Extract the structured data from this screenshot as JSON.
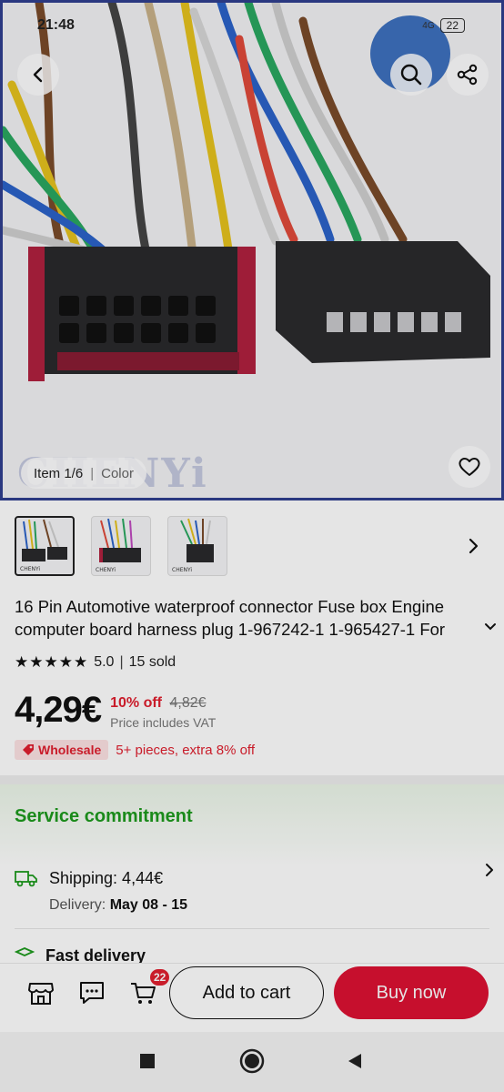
{
  "status_bar": {
    "time": "21:48",
    "signal": "4G",
    "battery": "22"
  },
  "hero": {
    "item_counter": "Item 1/6",
    "variant_label": "Color",
    "watermark": "CHENYi",
    "back_icon": "chevron-left-icon",
    "search_icon": "search-icon",
    "share_icon": "share-icon",
    "favorite_icon": "heart-icon"
  },
  "thumbnails": [
    {
      "label": "CHENYi",
      "active": true
    },
    {
      "label": "CHENYi",
      "active": false
    },
    {
      "label": "CHENYi",
      "active": false
    }
  ],
  "product": {
    "title": "16 Pin Automotive waterproof connector Fuse box Engine computer board harness plug 1-967242-1 1-965427-1 For",
    "rating": "5.0",
    "sold": "15 sold",
    "price": "4,29€",
    "discount": "10% off",
    "old_price": "4,82€",
    "vat_note": "Price includes VAT",
    "wholesale_badge": "Wholesale",
    "wholesale_text": "5+ pieces, extra 8% off"
  },
  "service": {
    "title": "Service commitment",
    "shipping_label": "Shipping: 4,44€",
    "delivery_prefix": "Delivery:",
    "delivery_dates": "May 08 - 15",
    "fast_delivery": "Fast delivery"
  },
  "bottom_bar": {
    "cart_count": "22",
    "add_to_cart": "Add to cart",
    "buy_now": "Buy now"
  },
  "colors": {
    "accent_red": "#dd1133",
    "discount_red": "#e0202f",
    "service_green": "#1d9a1d"
  }
}
